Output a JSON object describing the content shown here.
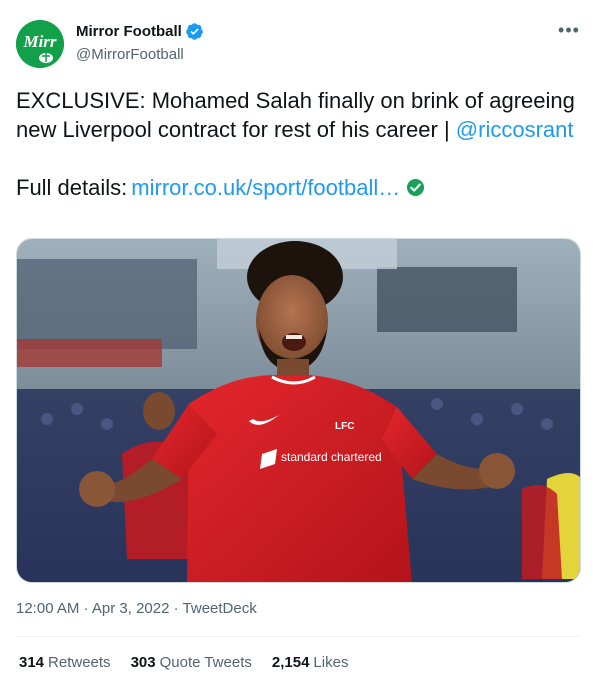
{
  "author": {
    "name": "Mirror Football",
    "handle": "@MirrorFootball",
    "avatar_text": "Mirr"
  },
  "tweet": {
    "text_main": "EXCLUSIVE: Mohamed Salah finally on brink of agreeing new Liverpool contract for rest of his career | ",
    "mention": "@riccosrant",
    "link_prefix": "Full details: ",
    "link_text": "mirror.co.uk/sport/football…"
  },
  "media": {
    "shirt_sponsor": "standard chartered",
    "badge_text": "LFC"
  },
  "meta": {
    "time": "12:00 AM",
    "date": "Apr 3, 2022",
    "source": "TweetDeck",
    "separator": " · "
  },
  "stats": [
    {
      "count": "314",
      "label": "Retweets"
    },
    {
      "count": "303",
      "label": "Quote Tweets"
    },
    {
      "count": "2,154",
      "label": "Likes"
    }
  ],
  "colors": {
    "accent": "#1d9bf0",
    "avatar_green": "#13a04a",
    "shirt_red": "#d71920",
    "verified_green": "#19a05a"
  },
  "icons": {
    "verified": "verified-badge-icon",
    "more": "more-options-icon",
    "link_check": "check-circle-icon"
  }
}
